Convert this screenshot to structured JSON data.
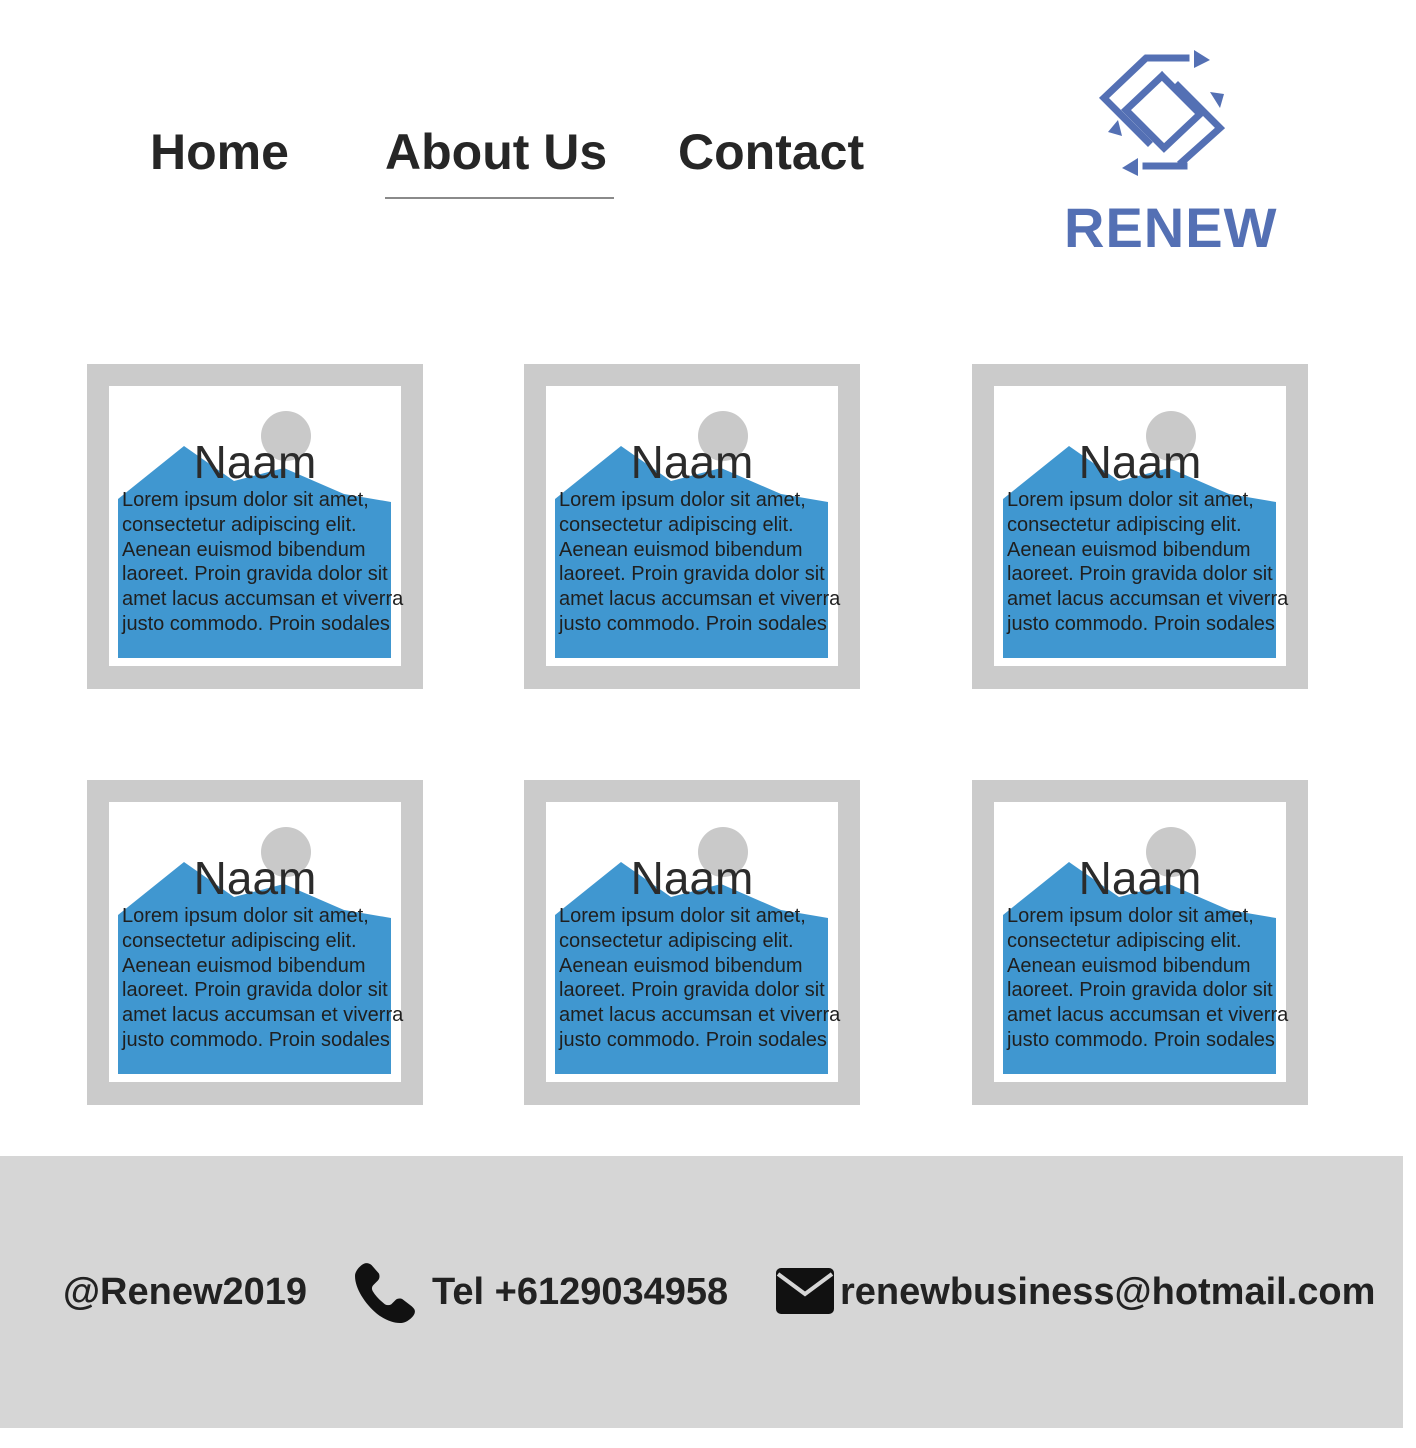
{
  "nav": {
    "home_label": "Home",
    "about_label": "About Us",
    "contact_label": "Contact",
    "active": "About Us"
  },
  "logo": {
    "text": "RENEW",
    "color": "#5470b4"
  },
  "cards": [
    {
      "name": "Naam",
      "text": "Lorem ipsum dolor sit amet, consectetur adipiscing elit. Aenean euismod bibendum laoreet. Proin gravida dolor sit amet lacus accumsan et viverra justo commodo. Proin sodales"
    },
    {
      "name": "Naam",
      "text": "Lorem ipsum dolor sit amet, consectetur adipiscing elit. Aenean euismod bibendum laoreet. Proin gravida dolor sit amet lacus accumsan et viverra justo commodo. Proin sodales"
    },
    {
      "name": "Naam",
      "text": "Lorem ipsum dolor sit amet, consectetur adipiscing elit. Aenean euismod bibendum laoreet. Proin gravida dolor sit amet lacus accumsan et viverra justo commodo. Proin sodales"
    },
    {
      "name": "Naam",
      "text": "Lorem ipsum dolor sit amet, consectetur adipiscing elit. Aenean euismod bibendum laoreet. Proin gravida dolor sit amet lacus accumsan et viverra justo commodo. Proin sodales"
    },
    {
      "name": "Naam",
      "text": "Lorem ipsum dolor sit amet, consectetur adipiscing elit. Aenean euismod bibendum laoreet. Proin gravida dolor sit amet lacus accumsan et viverra justo commodo. Proin sodales"
    },
    {
      "name": "Naam",
      "text": "Lorem ipsum dolor sit amet, consectetur adipiscing elit. Aenean euismod bibendum laoreet. Proin gravida dolor sit amet lacus accumsan et viverra justo commodo. Proin sodales"
    }
  ],
  "card_style": {
    "frame_color": "#cbcbcb",
    "image_color": "#4097d0",
    "sun_color": "#c9c9c9",
    "placeholder_icon": "image-placeholder-icon"
  },
  "footer": {
    "handle": "@Renew2019",
    "phone_icon": "phone-icon",
    "phone": "Tel +6129034958",
    "mail_icon": "mail-icon",
    "email": "renewbusiness@hotmail.com",
    "background": "#d6d6d6"
  }
}
